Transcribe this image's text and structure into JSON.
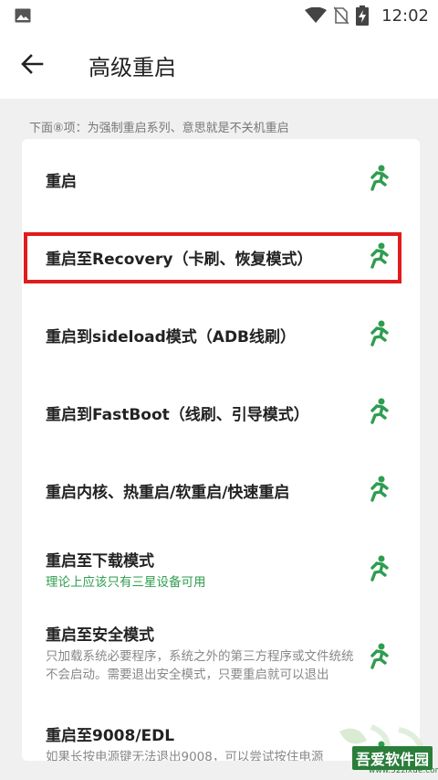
{
  "status_bar": {
    "time": "12:02",
    "icons": [
      "image-icon",
      "wifi-icon",
      "no-sim-icon",
      "battery-charging-icon"
    ]
  },
  "appbar": {
    "back_icon": "arrow-back-icon",
    "title": "高级重启"
  },
  "section_hint": "下面⑧项：为强制重启系列、意思就是不关机重启",
  "items": [
    {
      "title": "重启",
      "subtitle": "",
      "icon": "run-icon"
    },
    {
      "title": "重启至Recovery（卡刷、恢复模式）",
      "subtitle": "",
      "icon": "run-icon",
      "highlighted": true
    },
    {
      "title": "重启到sideload模式（ADB线刷）",
      "subtitle": "",
      "icon": "run-icon"
    },
    {
      "title": "重启到FastBoot（线刷、引导模式）",
      "subtitle": "",
      "icon": "run-icon"
    },
    {
      "title": "重启内核、热重启/软重启/快速重启",
      "subtitle": "",
      "icon": "run-icon"
    },
    {
      "title": "重启至下载模式",
      "subtitle": "理论上应该只有三星设备可用",
      "icon": "run-icon"
    },
    {
      "title": "重启至安全模式",
      "subtitle": "只加载系统必要程序，系统之外的第三方程序或文件统统不会启动。需要退出安全模式，只要重启就可以退出",
      "icon": "run-icon"
    },
    {
      "title": "重启至9008/EDL",
      "subtitle": "如果长按电源键无法退出9008，可以尝试按住电源",
      "icon": "run-icon"
    }
  ],
  "watermark": {
    "text": "吾爱软件园",
    "url": "www.52zixue.com"
  },
  "colors": {
    "accent_green": "#2e9d4f",
    "highlight_red": "#e11b1b"
  }
}
